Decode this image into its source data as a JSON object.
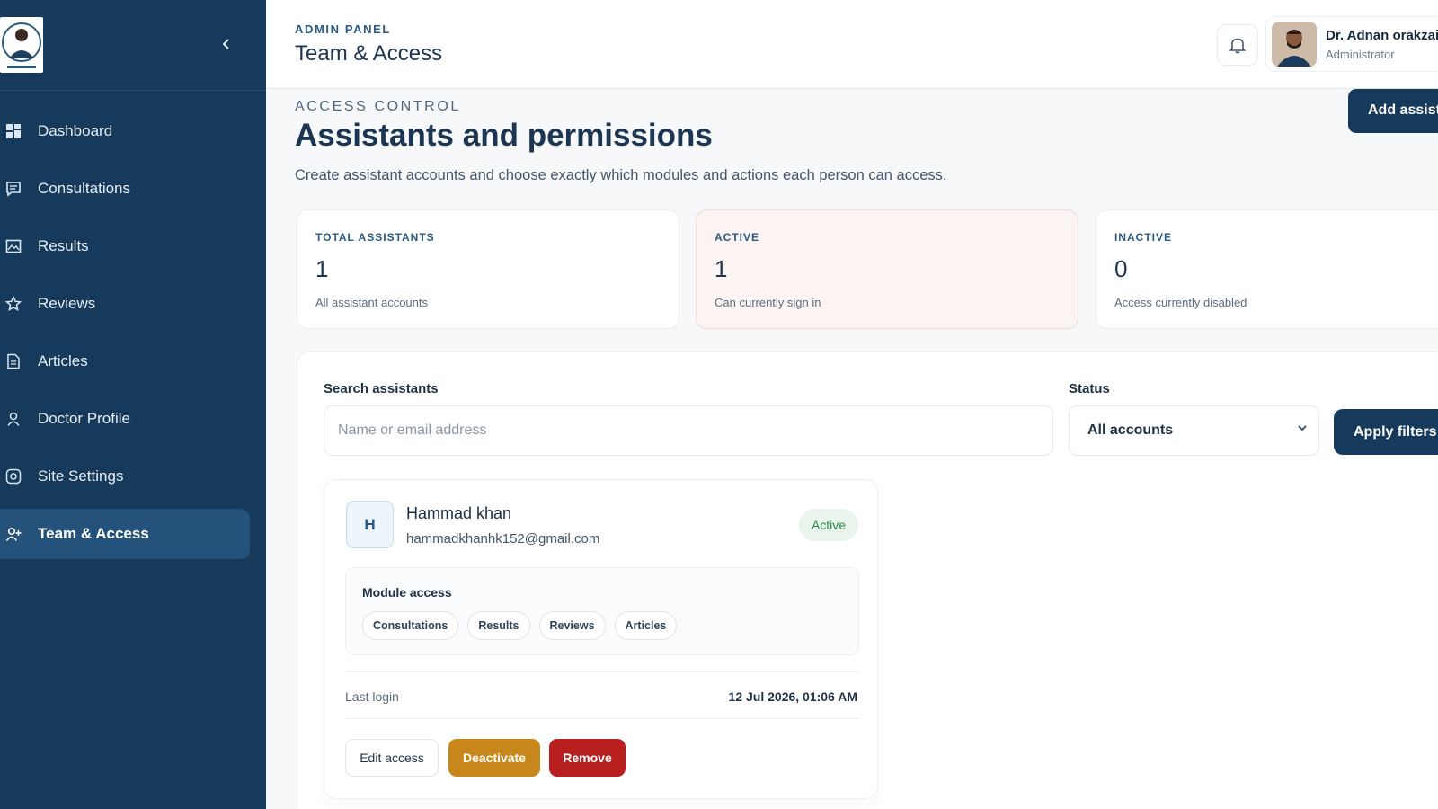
{
  "sidebar": {
    "items": [
      {
        "label": "Dashboard",
        "icon": "grid-icon"
      },
      {
        "label": "Consultations",
        "icon": "chat-icon"
      },
      {
        "label": "Results",
        "icon": "image-icon"
      },
      {
        "label": "Reviews",
        "icon": "star-icon"
      },
      {
        "label": "Articles",
        "icon": "document-icon"
      },
      {
        "label": "Doctor Profile",
        "icon": "person-icon"
      },
      {
        "label": "Site Settings",
        "icon": "settings-icon"
      },
      {
        "label": "Team & Access",
        "icon": "user-plus-icon",
        "active": true
      }
    ]
  },
  "header": {
    "eyebrow": "ADMIN PANEL",
    "title": "Team & Access",
    "user_name": "Dr. Adnan orakzai",
    "user_role": "Administrator"
  },
  "page": {
    "eyebrow": "ACCESS CONTROL",
    "title": "Assistants and permissions",
    "description": "Create assistant accounts and choose exactly which modules and actions each person can access.",
    "add_button": "Add assist"
  },
  "stats": [
    {
      "label": "TOTAL ASSISTANTS",
      "value": "1",
      "sub": "All assistant accounts"
    },
    {
      "label": "ACTIVE",
      "value": "1",
      "sub": "Can currently sign in"
    },
    {
      "label": "INACTIVE",
      "value": "0",
      "sub": "Access currently disabled"
    }
  ],
  "filters": {
    "search_label": "Search assistants",
    "search_placeholder": "Name or email address",
    "status_label": "Status",
    "status_value": "All accounts",
    "apply_label": "Apply filters"
  },
  "assistant": {
    "initial": "H",
    "name": "Hammad khan",
    "email": "hammadkhanhk152@gmail.com",
    "status": "Active",
    "module_title": "Module access",
    "modules": [
      "Consultations",
      "Results",
      "Reviews",
      "Articles"
    ],
    "last_login_label": "Last login",
    "last_login_value": "12 Jul 2026, 01:06 AM",
    "actions": {
      "edit": "Edit access",
      "deactivate": "Deactivate",
      "remove": "Remove"
    }
  },
  "colors": {
    "sidebar_bg": "#163a5c",
    "primary": "#163a5c",
    "active_green": "#2b8a4a",
    "deactivate": "#c8871a",
    "remove": "#b82020"
  }
}
